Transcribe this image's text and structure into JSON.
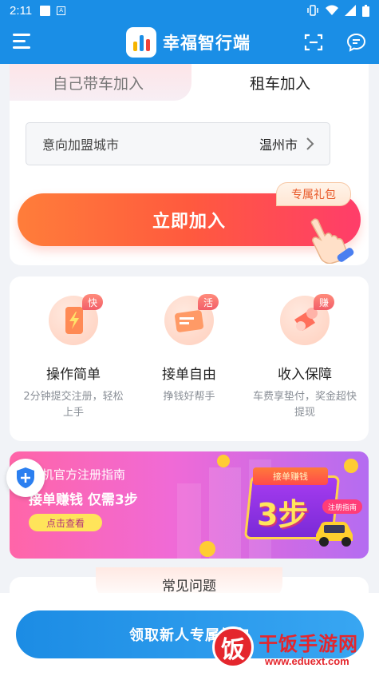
{
  "status_bar": {
    "time": "2:11",
    "icon_a": "A"
  },
  "header": {
    "title": "幸福智行端"
  },
  "tabs": [
    {
      "label": "自己带车加入",
      "active": false
    },
    {
      "label": "租车加入",
      "active": true
    }
  ],
  "city": {
    "label": "意向加盟城市",
    "value": "温州市"
  },
  "join": {
    "label": "立即加入",
    "gift_badge": "专属礼包"
  },
  "features": [
    {
      "badge": "快",
      "title": "操作简单",
      "desc": "2分钟提交注册，轻松上手",
      "icon": "lightning-phone-icon"
    },
    {
      "badge": "活",
      "title": "接单自由",
      "desc": "挣钱好帮手",
      "icon": "order-card-icon"
    },
    {
      "badge": "赚",
      "title": "收入保障",
      "desc": "车费享垫付，奖金超快提现",
      "icon": "money-bag-icon"
    }
  ],
  "banner": {
    "subtitle": "机官方注册指南",
    "title": "接单赚钱 仅需3步",
    "button": "点击查看",
    "ribbon": "接单赚钱",
    "big": "3步",
    "tag": "注册指南"
  },
  "faq": {
    "title": "常见问题"
  },
  "bottom": {
    "cta": "领取新人专属礼包"
  },
  "watermark": {
    "glyph": "饭",
    "text": "干饭手游网",
    "url": "www.eduext.com"
  },
  "colors": {
    "primary": "#1a8ee6",
    "accent": "#ff5a3e"
  }
}
